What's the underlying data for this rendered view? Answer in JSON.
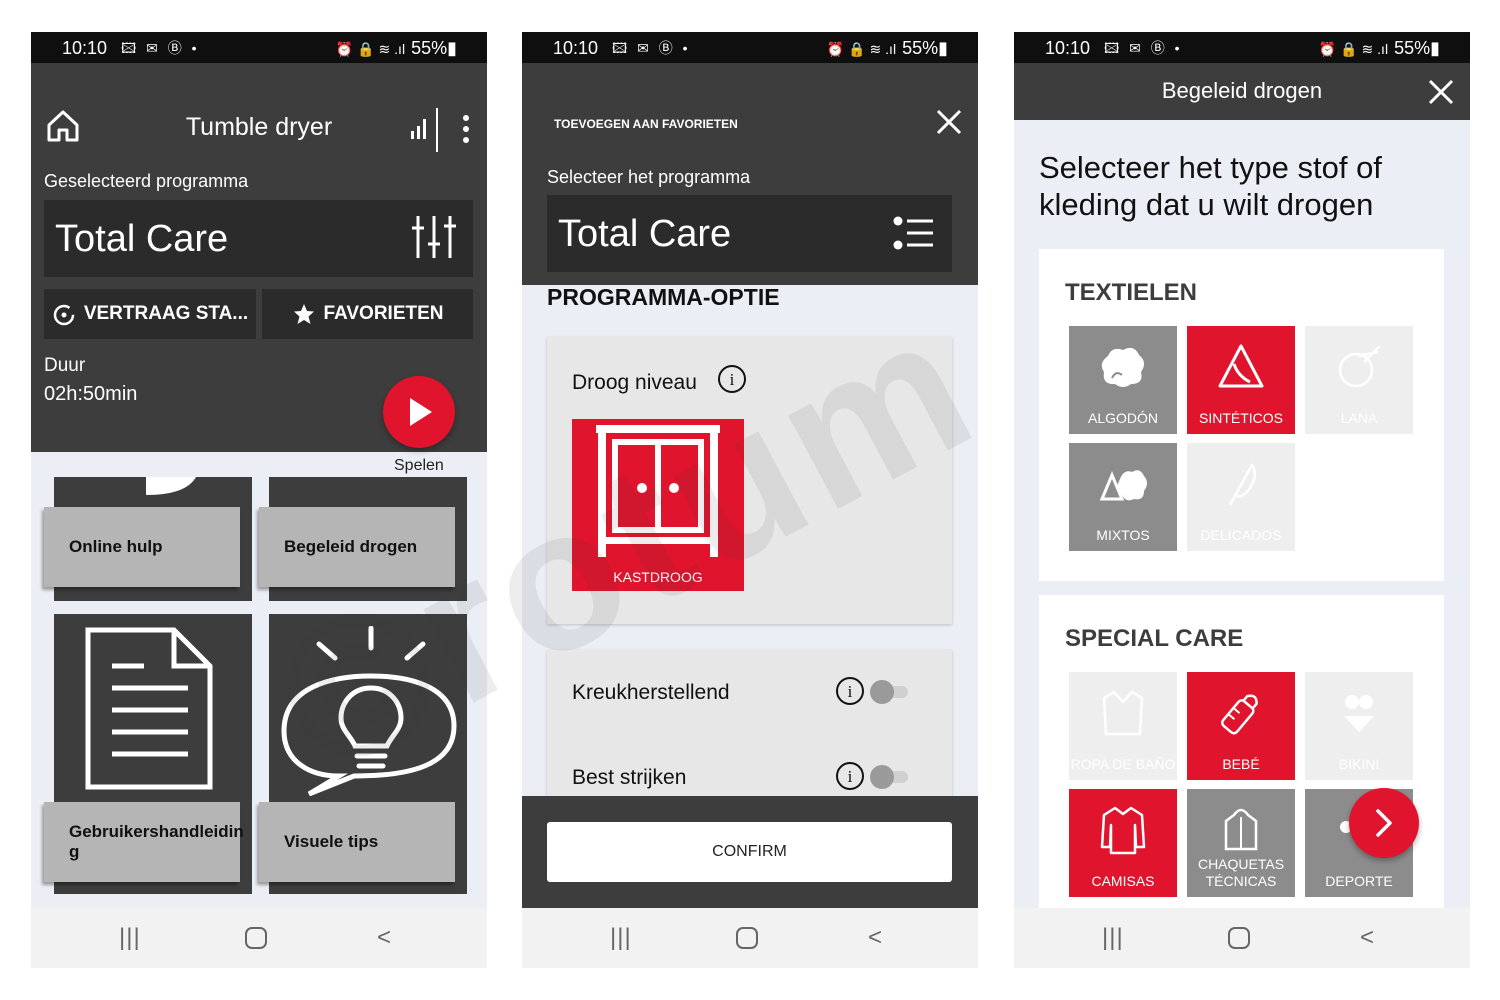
{
  "status_bar": {
    "time": "10:10",
    "left_icons": "🖾 ✉ Ⓑ •",
    "right_icons": "⏰ 🔒 ≋ .ıl",
    "battery": "55%▮"
  },
  "screen1": {
    "title": "Tumble dryer",
    "selected_label": "Geselecteerd programma",
    "program": "Total Care",
    "delay_button": "VERTRAAG STA...",
    "favorites_button": "FAVORIETEN",
    "duration_label": "Duur",
    "duration_value": "02h:50min",
    "play_label": "Spelen",
    "tiles": [
      {
        "label": "Online hulp"
      },
      {
        "label": "Begeleid drogen"
      },
      {
        "label": "Gebruikershandleidin g"
      },
      {
        "label": "Visuele tips"
      }
    ]
  },
  "screen2": {
    "header_title": "TOEVOEGEN AAN FAVORIETEN",
    "selected_label": "Selecteer het programma",
    "program": "Total Care",
    "section_title": "PROGRAMMA-OPTIE",
    "dry_level_label": "Droog niveau",
    "dry_level_tile": "KASTDROOG",
    "options": [
      {
        "label": "Kreukherstellend",
        "enabled": false
      },
      {
        "label": "Best strijken",
        "enabled": false
      }
    ],
    "confirm_button": "CONFIRM"
  },
  "screen3": {
    "title": "Begeleid drogen",
    "heading": "Selecteer het type stof of kleding dat u wilt drogen",
    "textiles_title": "TEXTIELEN",
    "textiles": [
      {
        "label": "ALGODÓN",
        "state": "available"
      },
      {
        "label": "SINTÉTICOS",
        "state": "selected"
      },
      {
        "label": "LANA",
        "state": "disabled"
      },
      {
        "label": "MIXTOS",
        "state": "available"
      },
      {
        "label": "DELICADOS",
        "state": "disabled"
      }
    ],
    "special_title": "SPECIAL CARE",
    "special": [
      {
        "label": "ROPA DE BAÑO",
        "state": "disabled"
      },
      {
        "label": "BEBÉ",
        "state": "selected"
      },
      {
        "label": "BIKINI",
        "state": "disabled"
      },
      {
        "label": "CAMISAS",
        "state": "selected"
      },
      {
        "label": "CHAQUETAS TÉCNICAS",
        "state": "available"
      },
      {
        "label": "DEPORTE",
        "state": "available"
      }
    ]
  },
  "watermark": "©rotum",
  "colors": {
    "dark": "#3d3d3d",
    "darker": "#2b2b2b",
    "accent_red": "#e0142d",
    "tile_grey": "#8c8c8c",
    "background": "#ebeef4"
  }
}
